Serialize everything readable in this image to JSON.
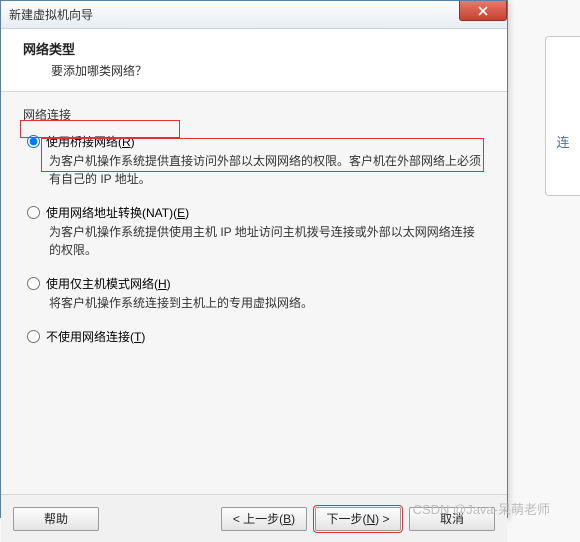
{
  "window": {
    "title": "新建虚拟机向导"
  },
  "header": {
    "title": "网络类型",
    "subtitle": "要添加哪类网络？"
  },
  "section_label": "网络连接",
  "options": {
    "bridged": {
      "label_pre": "使用桥接网络(",
      "accel": "R",
      "label_post": ")",
      "desc": "为客户机操作系统提供直接访问外部以太网网络的权限。客户机在外部网络上必须有自己的 IP 地址。"
    },
    "nat": {
      "label_pre": "使用网络地址转换(NAT)(",
      "accel": "E",
      "label_post": ")",
      "desc": "为客户机操作系统提供使用主机 IP 地址访问主机拨号连接或外部以太网网络连接的权限。"
    },
    "hostonly": {
      "label_pre": "使用仅主机模式网络(",
      "accel": "H",
      "label_post": ")",
      "desc": "将客户机操作系统连接到主机上的专用虚拟网络。"
    },
    "none": {
      "label_pre": "不使用网络连接(",
      "accel": "T",
      "label_post": ")"
    }
  },
  "buttons": {
    "help": "帮助",
    "back_pre": "< 上一步(",
    "back_accel": "B",
    "back_post": ")",
    "next_pre": "下一步(",
    "next_accel": "N",
    "next_post": ") >",
    "cancel": "取消"
  },
  "side": {
    "label": "连"
  },
  "watermark": "CSDN @Java-呆萌老师"
}
